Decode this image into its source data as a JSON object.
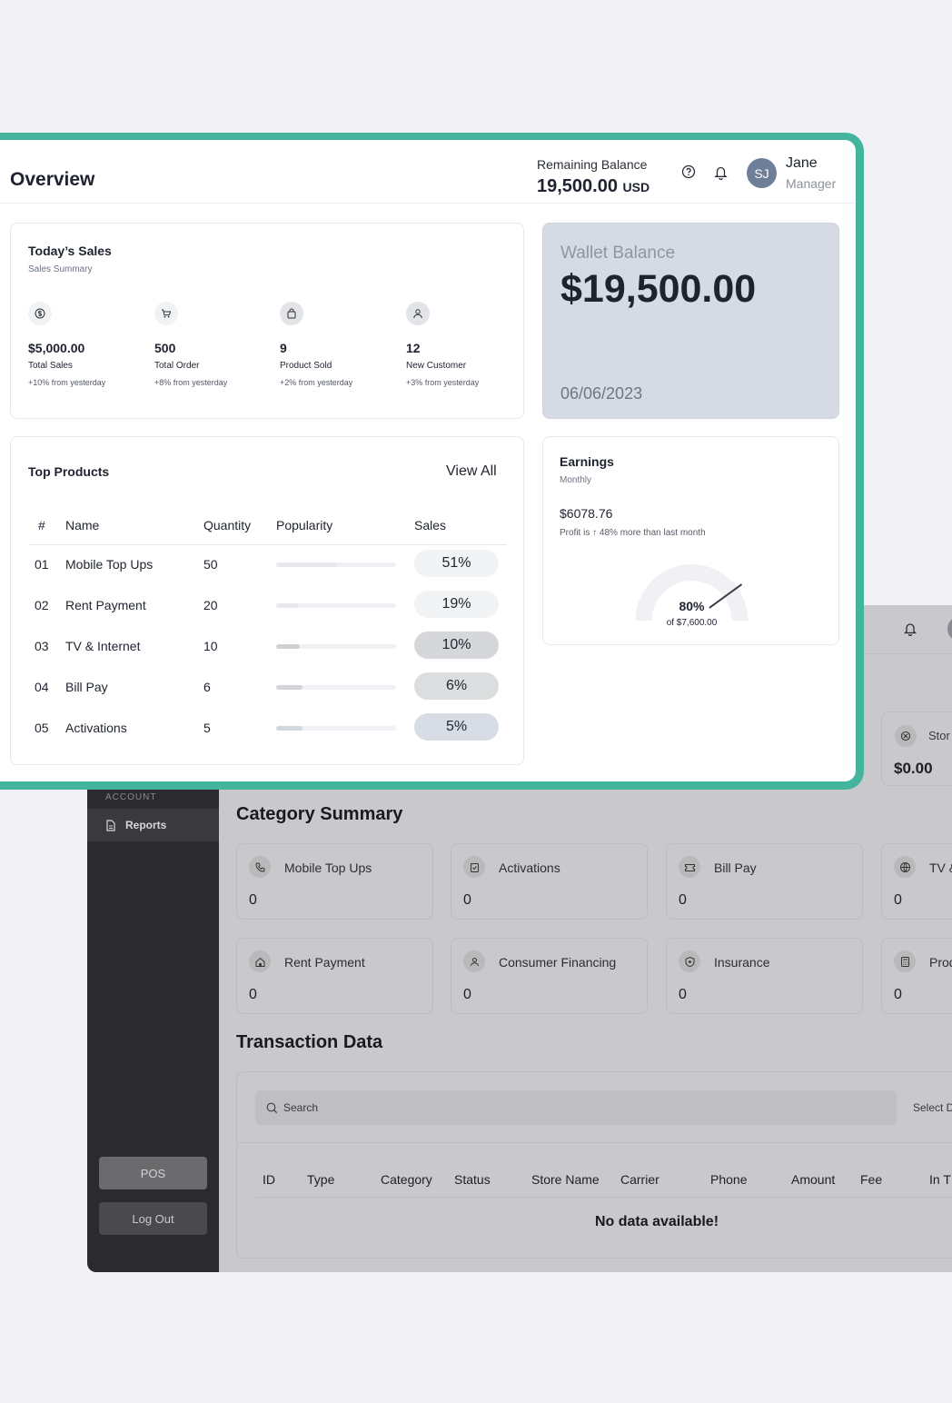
{
  "background": {
    "sidebar": {
      "section_label": "ACCOUNT",
      "reports_label": "Reports",
      "pos_label": "POS",
      "logout_label": "Log Out"
    },
    "store_card": {
      "label": "Stor",
      "value": "$0.00"
    },
    "category_summary": {
      "title": "Category Summary",
      "items": [
        {
          "label": "Mobile Top Ups",
          "value": "0",
          "icon": "phone-icon"
        },
        {
          "label": "Activations",
          "value": "0",
          "icon": "clipboard-check-icon"
        },
        {
          "label": "Bill Pay",
          "value": "0",
          "icon": "ticket-icon"
        },
        {
          "label": "TV &",
          "value": "0",
          "icon": "globe-icon"
        },
        {
          "label": "Rent Payment",
          "value": "0",
          "icon": "home-icon"
        },
        {
          "label": "Consumer Financing",
          "value": "0",
          "icon": "users-icon"
        },
        {
          "label": "Insurance",
          "value": "0",
          "icon": "shield-icon"
        },
        {
          "label": "Prod",
          "value": "0",
          "icon": "calculator-icon"
        }
      ]
    },
    "transactions": {
      "title": "Transaction Data",
      "search_placeholder": "Search",
      "select_label": "Select D",
      "columns": [
        "ID",
        "Type",
        "Category",
        "Status",
        "Store Name",
        "Carrier",
        "Phone",
        "Amount",
        "Fee",
        "In T"
      ],
      "empty_text": "No data available!"
    }
  },
  "overview": {
    "title": "Overview",
    "remaining_balance_label": "Remaining Balance",
    "remaining_balance_value": "19,500.00",
    "remaining_balance_currency": "USD",
    "user": {
      "initials": "SJ",
      "name": "Jane",
      "role": "Manager"
    },
    "todays_sales": {
      "title": "Today’s Sales",
      "subtitle": "Sales Summary",
      "stats": [
        {
          "value": "$5,000.00",
          "label": "Total Sales",
          "change": "+10% from yesterday",
          "icon": "dollar-circle-icon"
        },
        {
          "value": "500",
          "label": "Total Order",
          "change": "+8% from yesterday",
          "icon": "cart-icon"
        },
        {
          "value": "9",
          "label": "Product Sold",
          "change": "+2% from yesterday",
          "icon": "bag-icon"
        },
        {
          "value": "12",
          "label": "New Customer",
          "change": "+3% from yesterday",
          "icon": "user-icon"
        }
      ]
    },
    "wallet": {
      "label": "Wallet Balance",
      "value": "$19,500.00",
      "date": "06/06/2023"
    },
    "top_products": {
      "title": "Top Products",
      "view_all": "View All",
      "columns": [
        "#",
        "Name",
        "Quantity",
        "Popularity",
        "Sales"
      ],
      "rows": [
        {
          "num": "01",
          "name": "Mobile Top Ups",
          "quantity": "50",
          "sales": "51%",
          "popularity": 0.51,
          "pill_color": "#f2f3f5",
          "bar_color": "#e8e9ec"
        },
        {
          "num": "02",
          "name": "Rent Payment",
          "quantity": "20",
          "sales": "19%",
          "popularity": 0.19,
          "pill_color": "#f2f3f5",
          "bar_color": "#e8e9ec"
        },
        {
          "num": "03",
          "name": "TV & Internet",
          "quantity": "10",
          "sales": "10%",
          "popularity": 0.2,
          "pill_color": "#d6d7da",
          "bar_color": "#cfd0d4"
        },
        {
          "num": "04",
          "name": "Bill Pay",
          "quantity": "6",
          "sales": "6%",
          "popularity": 0.22,
          "pill_color": "#dcdddf",
          "bar_color": "#d3d4d7"
        },
        {
          "num": "05",
          "name": "Activations",
          "quantity": "5",
          "sales": "5%",
          "popularity": 0.22,
          "pill_color": "#d8dde5",
          "bar_color": "#d2d6de"
        }
      ]
    },
    "earnings": {
      "title": "Earnings",
      "period": "Monthly",
      "amount": "$6078.76",
      "profit_text": "Profit is ↑ 48% more than last month",
      "gauge_percent_label": "80%",
      "gauge_percent": 0.8,
      "gauge_of": "of $7,600.00"
    }
  }
}
